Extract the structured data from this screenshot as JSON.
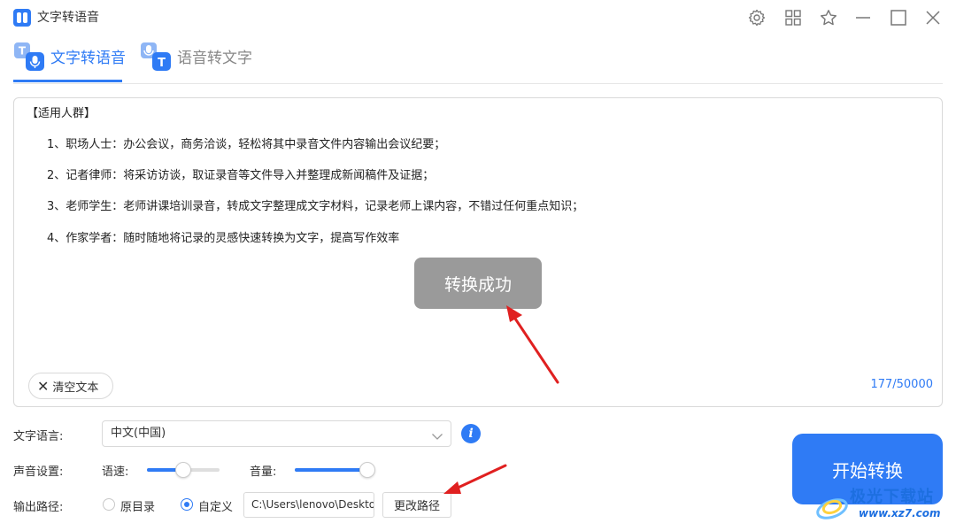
{
  "window": {
    "title": "文字转语音"
  },
  "tabs": [
    {
      "label": "文字转语音",
      "active": true
    },
    {
      "label": "语音转文字",
      "active": false
    }
  ],
  "textbox": {
    "lines": [
      "【适用人群】",
      "1、职场人士：办公会议，商务洽谈，轻松将其中录音文件内容输出会议纪要；",
      "2、记者律师：将采访访谈，取证录音等文件导入并整理成新闻稿件及证据；",
      "3、老师学生：老师讲课培训录音，转成文字整理成文字材料，记录老师上课内容，不错过任何重点知识；",
      "4、作家学者：随时随地将记录的灵感快速转换为文字，提高写作效率"
    ],
    "clear_label": "清空文本",
    "counter": "177/50000"
  },
  "toast": {
    "text": "转换成功"
  },
  "settings": {
    "language_label": "文字语言:",
    "language_value": "中文(中国)",
    "voice_label": "声音设置:",
    "speed_label": "语速:",
    "speed_value": 0.5,
    "volume_label": "音量:",
    "volume_value": 1.0,
    "output_label": "输出路径:",
    "output_options": [
      {
        "label": "原目录",
        "selected": false
      },
      {
        "label": "自定义",
        "selected": true
      }
    ],
    "output_path": "C:\\Users\\lenovo\\Desktop",
    "change_path_label": "更改路径"
  },
  "start_button": {
    "label": "开始转换"
  },
  "watermark": {
    "text": "极光下载站",
    "url": "www.xz7.com"
  },
  "colors": {
    "accent": "#2f7bf5",
    "arrow": "#e02020"
  },
  "icons": [
    "app-logo-icon",
    "gear-icon",
    "grid-icon",
    "star-icon",
    "minimize-icon",
    "maximize-icon",
    "close-icon",
    "text-to-speech-icon",
    "speech-to-text-icon",
    "clear-x-icon",
    "chevron-down-icon",
    "info-icon"
  ]
}
